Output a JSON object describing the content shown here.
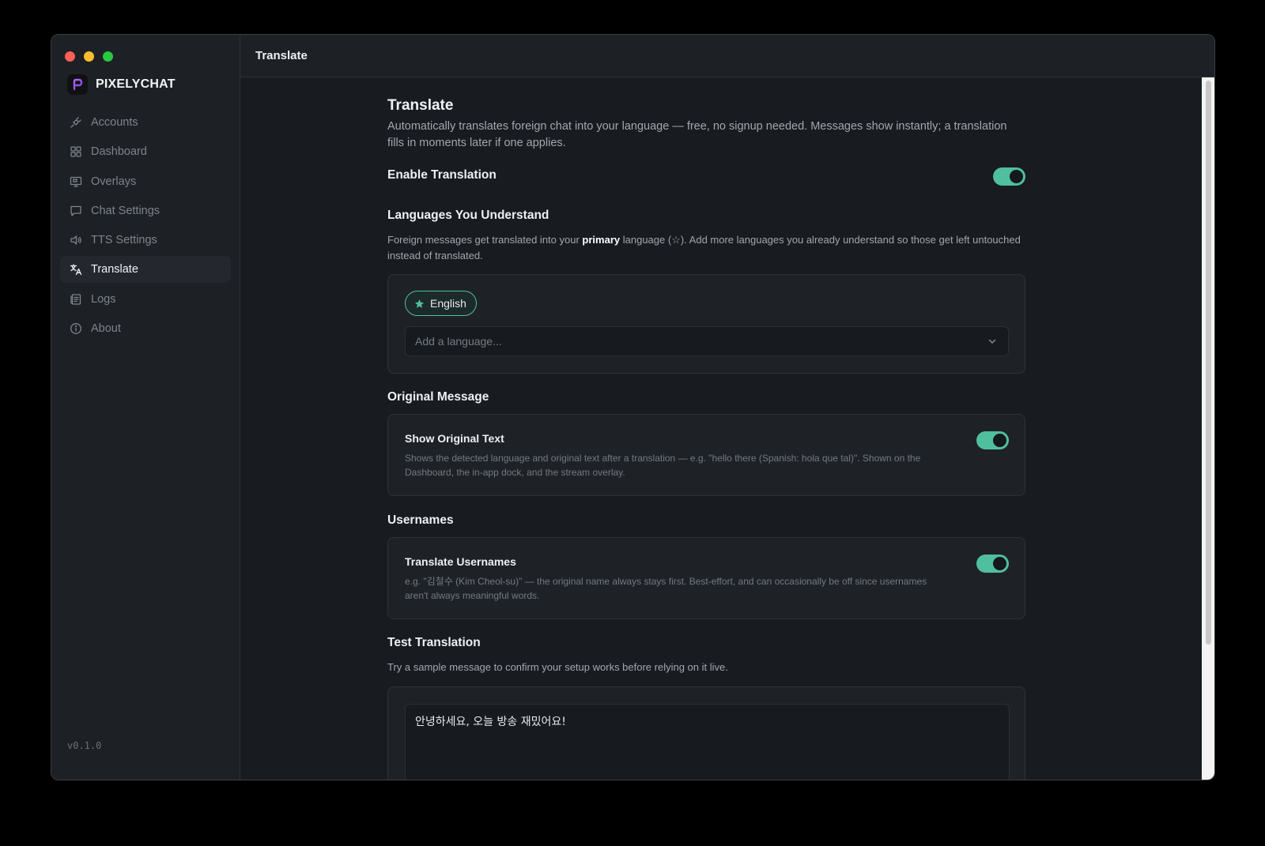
{
  "app": {
    "name": "PIXELYCHAT",
    "version": "v0.1.0",
    "accent": "#4fbf9d"
  },
  "sidebar": {
    "items": [
      {
        "label": "Accounts",
        "icon": "plug-icon"
      },
      {
        "label": "Dashboard",
        "icon": "grid-icon"
      },
      {
        "label": "Overlays",
        "icon": "monitor-icon"
      },
      {
        "label": "Chat Settings",
        "icon": "chat-icon"
      },
      {
        "label": "TTS Settings",
        "icon": "speaker-icon"
      },
      {
        "label": "Translate",
        "icon": "translate-icon",
        "active": true
      },
      {
        "label": "Logs",
        "icon": "log-icon"
      },
      {
        "label": "About",
        "icon": "info-icon"
      }
    ]
  },
  "topbar": {
    "title": "Translate"
  },
  "main": {
    "title": "Translate",
    "description": "Automatically translates foreign chat into your language — free, no signup needed. Messages show instantly; a translation fills in moments later if one applies.",
    "enable": {
      "label": "Enable Translation",
      "on": true
    },
    "languages": {
      "heading": "Languages You Understand",
      "desc_before": "Foreign messages get translated into your ",
      "desc_bold": "primary",
      "desc_after": " language (☆). Add more languages you already understand so those get left untouched instead of translated.",
      "chips": [
        "English"
      ],
      "add_placeholder": "Add a language..."
    },
    "original": {
      "heading": "Original Message",
      "title": "Show Original Text",
      "description": "Shows the detected language and original text after a translation — e.g. \"hello there (Spanish: hola que tal)\". Shown on the Dashboard, the in-app dock, and the stream overlay.",
      "on": true
    },
    "usernames": {
      "heading": "Usernames",
      "title": "Translate Usernames",
      "description": "e.g. \"김철수 (Kim Cheol-su)\" — the original name always stays first. Best-effort, and can occasionally be off since usernames aren't always meaningful words.",
      "on": true
    },
    "test": {
      "heading": "Test Translation",
      "description": "Try a sample message to confirm your setup works before relying on it live.",
      "sample": "안녕하세요, 오늘 방송 재밌어요!"
    }
  }
}
